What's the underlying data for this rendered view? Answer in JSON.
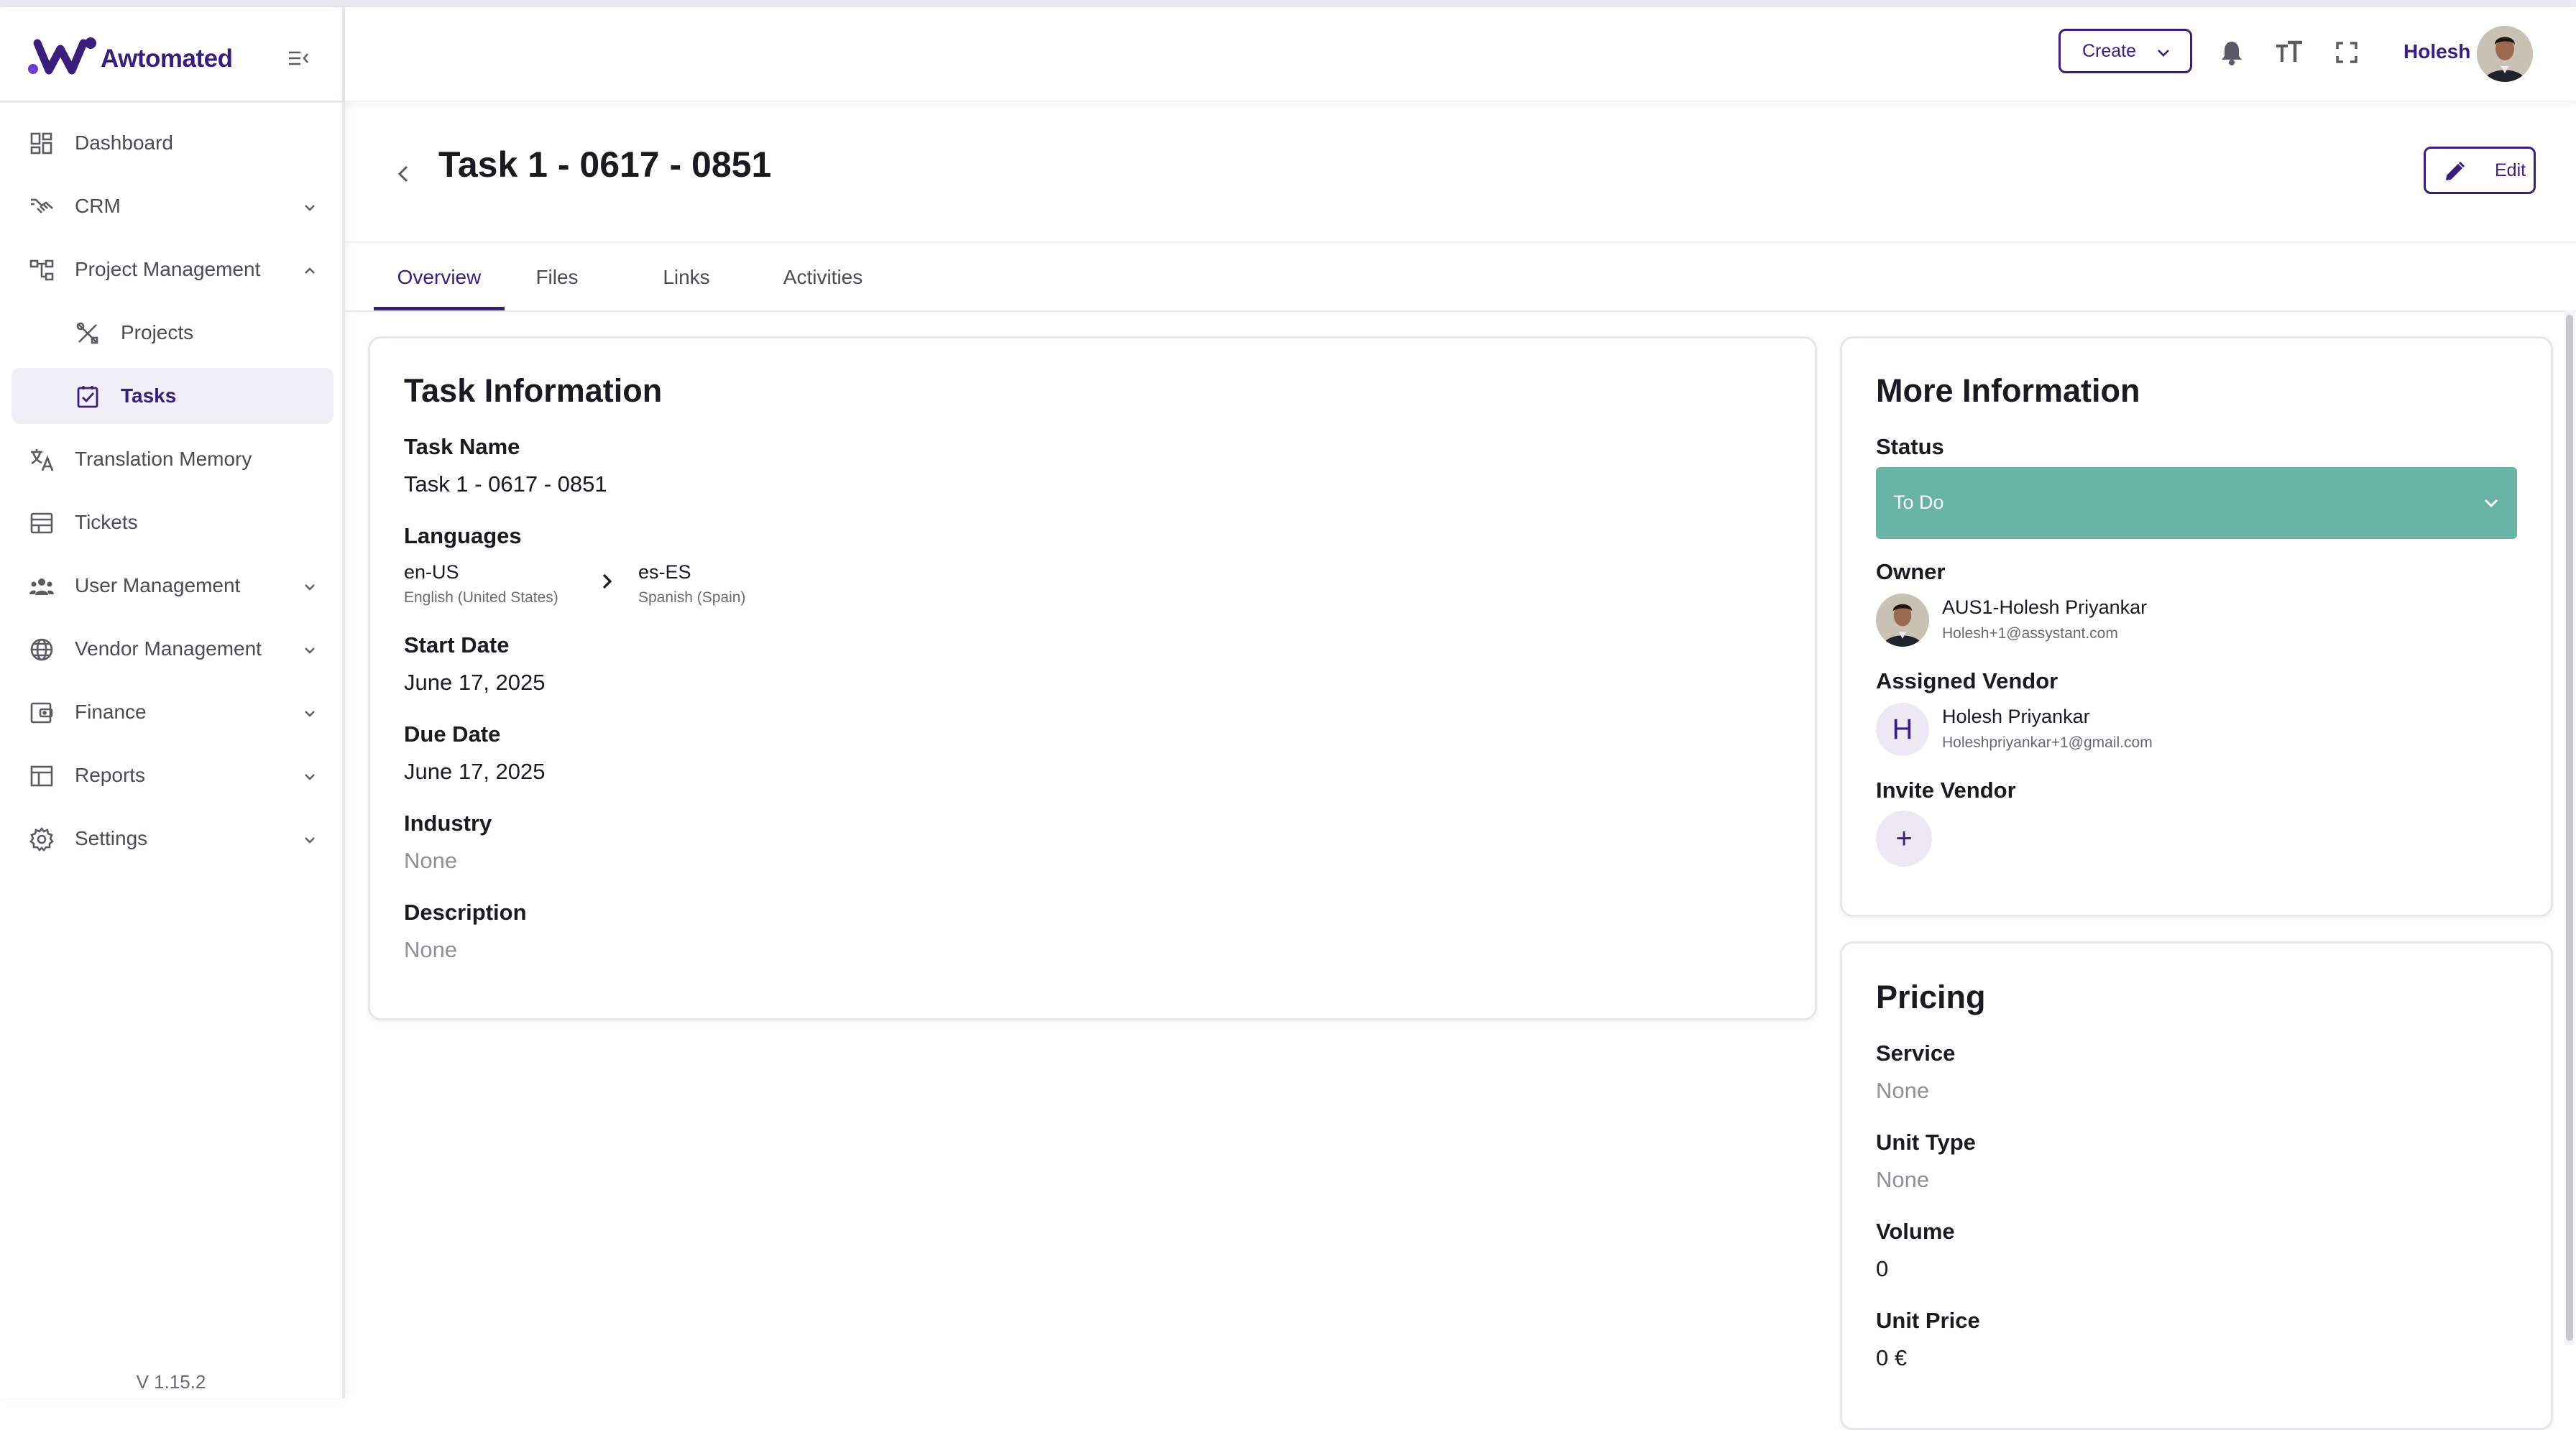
{
  "brand": {
    "name": "Awtomated",
    "color": "#3b1d7e"
  },
  "sidebar": {
    "items": [
      {
        "label": "Dashboard",
        "icon": "dashboard-icon"
      },
      {
        "label": "CRM",
        "icon": "handshake-icon",
        "expandable": true
      },
      {
        "label": "Project Management",
        "icon": "hierarchy-icon",
        "expandable": true,
        "expanded": true
      },
      {
        "label": "Projects",
        "icon": "tools-icon",
        "sub": true
      },
      {
        "label": "Tasks",
        "icon": "checkbox-icon",
        "sub": true,
        "active": true
      },
      {
        "label": "Translation Memory",
        "icon": "translate-icon"
      },
      {
        "label": "Tickets",
        "icon": "tickets-icon"
      },
      {
        "label": "User Management",
        "icon": "users-icon",
        "expandable": true
      },
      {
        "label": "Vendor Management",
        "icon": "globe-icon",
        "expandable": true
      },
      {
        "label": "Finance",
        "icon": "wallet-icon",
        "expandable": true
      },
      {
        "label": "Reports",
        "icon": "table-icon",
        "expandable": true
      },
      {
        "label": "Settings",
        "icon": "gear-icon",
        "expandable": true
      }
    ],
    "version": "V 1.15.2"
  },
  "header": {
    "create_label": "Create",
    "user_name": "Holesh"
  },
  "page": {
    "title": "Task 1 - 0617 - 0851",
    "edit_label": "Edit",
    "tabs": [
      {
        "label": "Overview",
        "active": true
      },
      {
        "label": "Files"
      },
      {
        "label": "Links"
      },
      {
        "label": "Activities"
      }
    ]
  },
  "task_info": {
    "title": "Task Information",
    "task_name_label": "Task Name",
    "task_name": "Task 1 - 0617 - 0851",
    "languages_label": "Languages",
    "source_code": "en-US",
    "source_name": "English (United States)",
    "target_code": "es-ES",
    "target_name": "Spanish (Spain)",
    "start_date_label": "Start Date",
    "start_date": "June 17, 2025",
    "due_date_label": "Due Date",
    "due_date": "June 17, 2025",
    "industry_label": "Industry",
    "industry": "None",
    "description_label": "Description",
    "description": "None"
  },
  "more_info": {
    "title": "More Information",
    "status_label": "Status",
    "status": "To Do",
    "status_color": "#68b3a5",
    "owner_label": "Owner",
    "owner_name": "AUS1-Holesh Priyankar",
    "owner_email": "Holesh+1@assystant.com",
    "vendor_label": "Assigned Vendor",
    "vendor_initial": "H",
    "vendor_name": "Holesh Priyankar",
    "vendor_email": "Holeshpriyankar+1@gmail.com",
    "invite_label": "Invite Vendor",
    "invite_symbol": "+"
  },
  "pricing": {
    "title": "Pricing",
    "service_label": "Service",
    "service": "None",
    "unit_type_label": "Unit Type",
    "unit_type": "None",
    "volume_label": "Volume",
    "volume": "0",
    "unit_price_label": "Unit Price",
    "unit_price": "0 €"
  }
}
